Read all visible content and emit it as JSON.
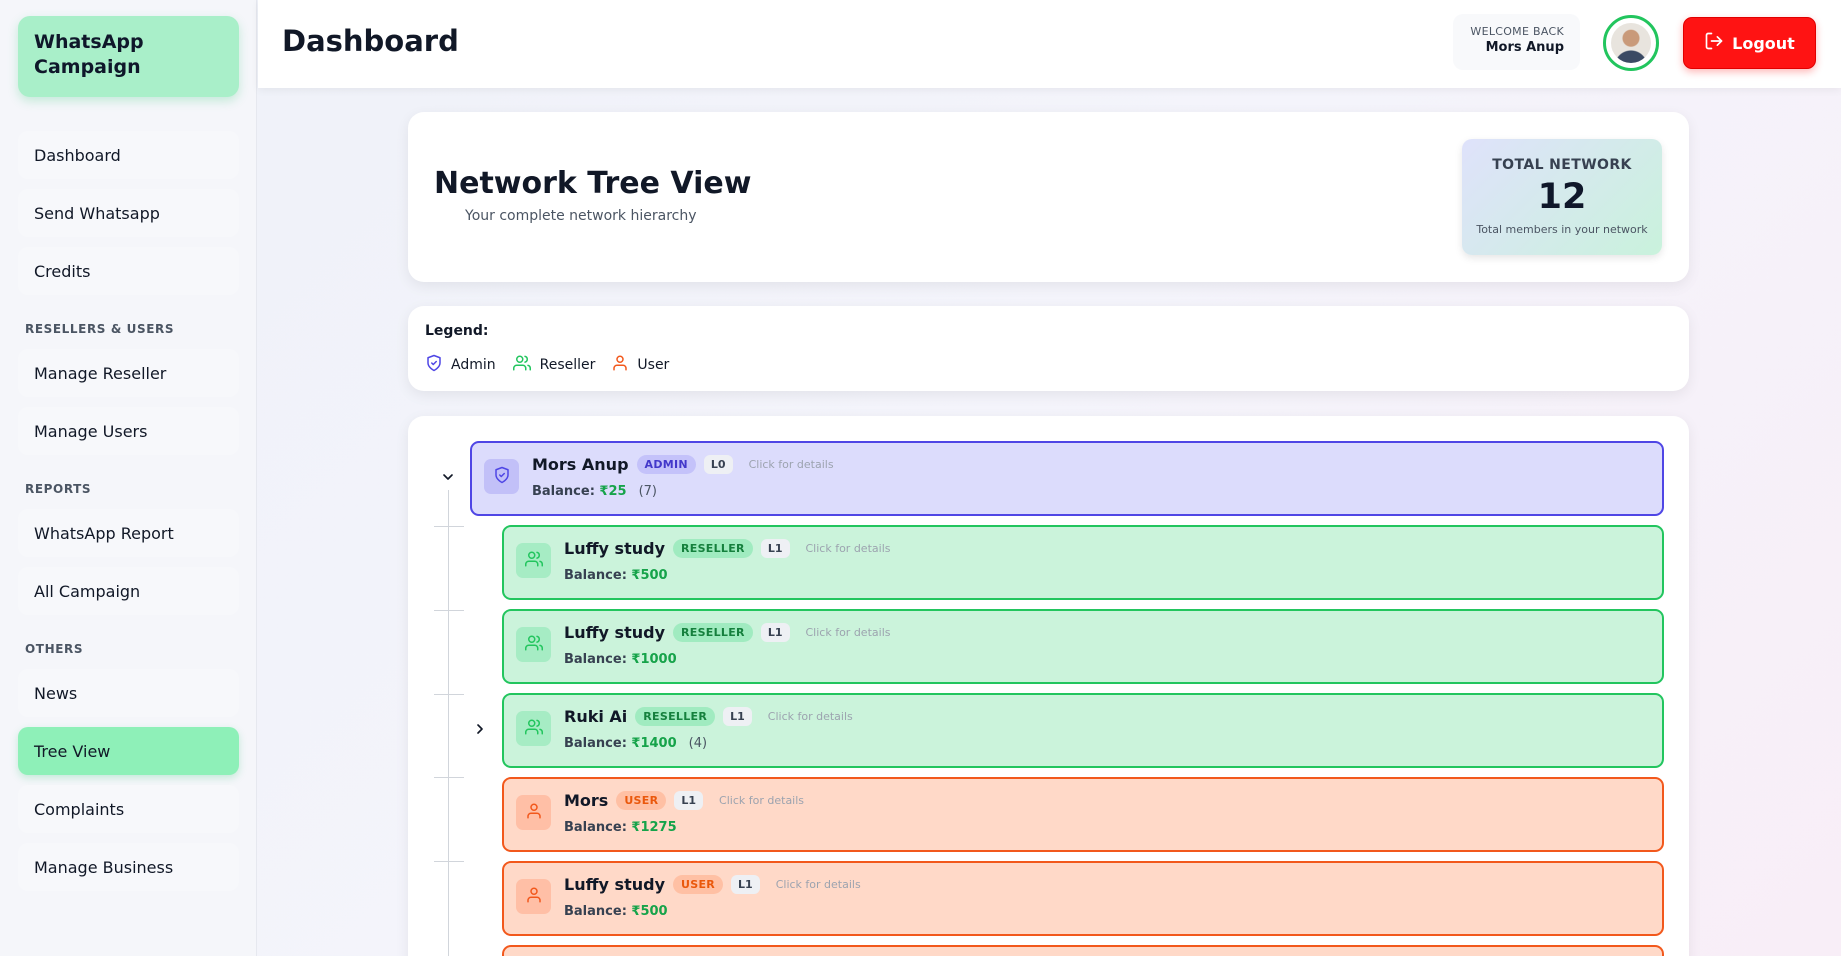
{
  "sidebar": {
    "brand": "WhatsApp Campaign",
    "items_top": [
      "Dashboard",
      "Send Whatsapp",
      "Credits"
    ],
    "section_resellers": "RESELLERS & USERS",
    "items_resellers": [
      "Manage Reseller",
      "Manage Users"
    ],
    "section_reports": "REPORTS",
    "items_reports": [
      "WhatsApp Report",
      "All Campaign"
    ],
    "section_others": "OTHERS",
    "items_others": [
      "News",
      "Tree View",
      "Complaints",
      "Manage Business"
    ],
    "active_item": "Tree View"
  },
  "header": {
    "title": "Dashboard",
    "welcome_label": "WELCOME BACK",
    "user_name": "Mors Anup",
    "logout_label": "Logout"
  },
  "tree_header": {
    "title": "Network Tree View",
    "subtitle": "Your complete network hierarchy",
    "total_label": "TOTAL NETWORK",
    "total_value": "12",
    "total_caption": "Total members in your network"
  },
  "legend": {
    "title": "Legend:",
    "items": [
      "Admin",
      "Reseller",
      "User"
    ]
  },
  "colors": {
    "admin": "#4f46e5",
    "reseller": "#22c55e",
    "user": "#f2581c",
    "logout": "#ff1313",
    "active_nav": "#8ef0b8"
  },
  "nodes": [
    {
      "name": "Mors Anup",
      "role": "ADMIN",
      "level": "L0",
      "balance_label": "Balance:",
      "amount": "₹25",
      "count": "(7)",
      "hint": "Click for details",
      "expanded": true
    },
    {
      "name": "Luffy study",
      "role": "RESELLER",
      "level": "L1",
      "balance_label": "Balance:",
      "amount": "₹500",
      "count": "",
      "hint": "Click for details"
    },
    {
      "name": "Luffy study",
      "role": "RESELLER",
      "level": "L1",
      "balance_label": "Balance:",
      "amount": "₹1000",
      "count": "",
      "hint": "Click for details"
    },
    {
      "name": "Ruki Ai",
      "role": "RESELLER",
      "level": "L1",
      "balance_label": "Balance:",
      "amount": "₹1400",
      "count": "(4)",
      "hint": "Click for details",
      "expanded": false
    },
    {
      "name": "Mors",
      "role": "USER",
      "level": "L1",
      "balance_label": "Balance:",
      "amount": "₹1275",
      "count": "",
      "hint": "Click for details"
    },
    {
      "name": "Luffy study",
      "role": "USER",
      "level": "L1",
      "balance_label": "Balance:",
      "amount": "₹500",
      "count": "",
      "hint": "Click for details"
    }
  ]
}
